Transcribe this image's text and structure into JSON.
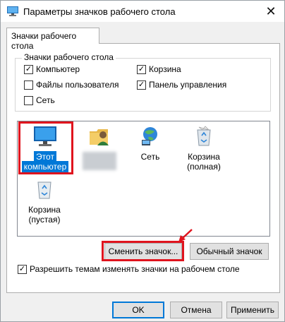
{
  "window": {
    "title": "Параметры значков рабочего стола",
    "close_glyph": "✕"
  },
  "tab": {
    "label": "Значки рабочего стола"
  },
  "group": {
    "label": "Значки рабочего стола",
    "checkboxes": [
      {
        "label": "Компьютер",
        "checked": true
      },
      {
        "label": "Корзина",
        "checked": true
      },
      {
        "label": "Файлы пользователя",
        "checked": false
      },
      {
        "label": "Панель управления",
        "checked": true
      },
      {
        "label": "Сеть",
        "checked": false
      }
    ]
  },
  "icons": [
    {
      "label": "Этот компьютер",
      "line1": "Этот",
      "line2": "компьютер",
      "icon": "monitor-icon",
      "selected": true
    },
    {
      "label": "",
      "icon": "user-folder-icon",
      "blurred": true
    },
    {
      "label": "Сеть",
      "icon": "network-globe-icon"
    },
    {
      "label": "Корзина (полная)",
      "line1": "Корзина",
      "line2": "(полная)",
      "icon": "recycle-bin-full-icon"
    },
    {
      "label": "Корзина (пустая)",
      "line1": "Корзина",
      "line2": "(пустая)",
      "icon": "recycle-bin-empty-icon"
    }
  ],
  "buttons": {
    "change_icon": "Сменить значок...",
    "default_icon": "Обычный значок",
    "ok": "OK",
    "cancel": "Отмена",
    "apply": "Применить"
  },
  "themes_checkbox": {
    "label": "Разрешить темам изменять значки на рабочем столе",
    "checked": true
  },
  "colors": {
    "accent": "#0078d7",
    "highlight_red": "#e0141e",
    "window_bg": "#f0f0f0"
  }
}
